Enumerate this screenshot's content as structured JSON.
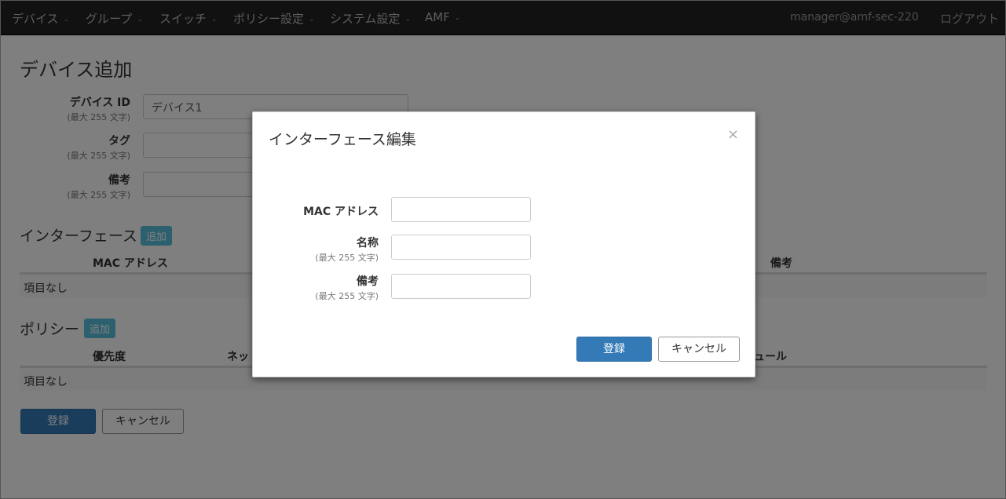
{
  "nav": {
    "items": [
      {
        "label": "デバイス"
      },
      {
        "label": "グループ"
      },
      {
        "label": "スイッチ"
      },
      {
        "label": "ポリシー設定"
      },
      {
        "label": "システム設定"
      },
      {
        "label": "AMF"
      }
    ],
    "caret": "⌄",
    "user": "manager@amf-sec-220",
    "logout": "ログアウト"
  },
  "page": {
    "title": "デバイス追加",
    "fields": {
      "device_id": {
        "label": "デバイス ID",
        "hint": "(最大 255 文字)",
        "value": "デバイス1"
      },
      "tag": {
        "label": "タグ",
        "hint": "(最大 255 文字)",
        "value": ""
      },
      "note": {
        "label": "備考",
        "hint": "(最大 255 文字)",
        "value": ""
      }
    },
    "interfaces": {
      "title": "インターフェース",
      "add": "追加",
      "headers": [
        "MAC アドレス",
        "備考"
      ],
      "empty": "項目なし"
    },
    "policies": {
      "title": "ポリシー",
      "add": "追加",
      "headers": [
        "優先度",
        "ネッ",
        "ュール"
      ],
      "empty": "項目なし"
    },
    "register": "登録",
    "cancel": "キャンセル"
  },
  "modal": {
    "title": "インターフェース編集",
    "close": "×",
    "fields": {
      "mac": {
        "label": "MAC アドレス",
        "value": ""
      },
      "name": {
        "label": "名称",
        "hint": "(最大 255 文字)",
        "value": ""
      },
      "note": {
        "label": "備考",
        "hint": "(最大 255 文字)",
        "value": ""
      }
    },
    "register": "登録",
    "cancel": "キャンセル"
  },
  "colors": {
    "navbar": "#222222",
    "primary": "#337ab7",
    "info": "#5bc0de",
    "backdrop": "rgba(0,0,0,0.5)"
  }
}
